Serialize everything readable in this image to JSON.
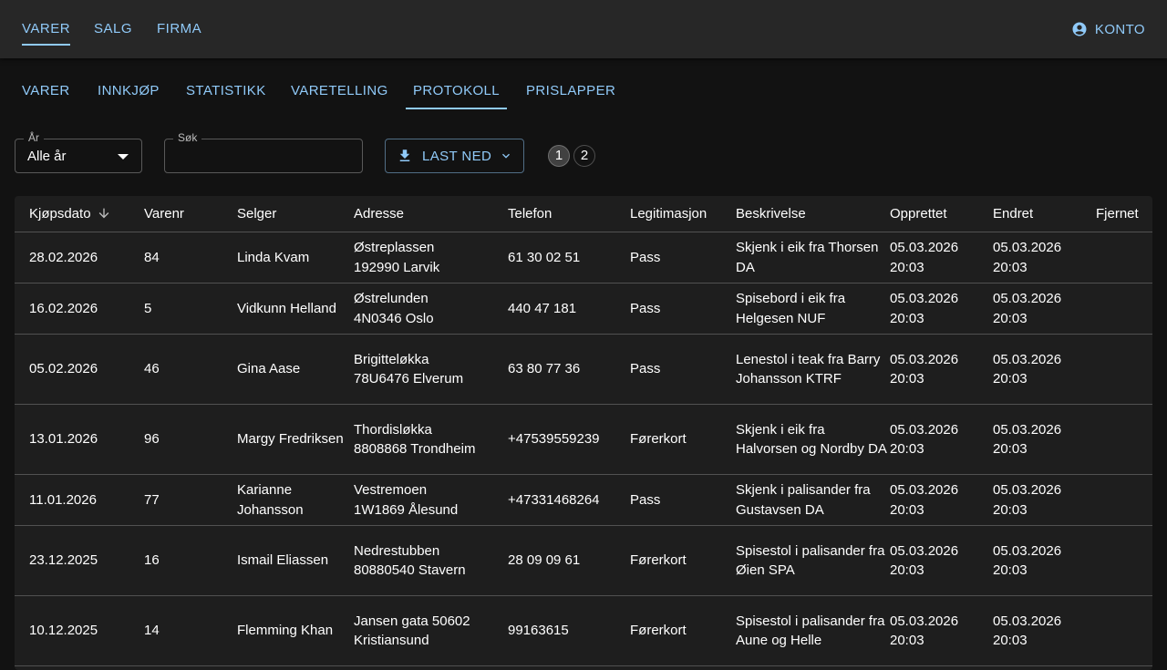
{
  "topnav": {
    "items": [
      {
        "label": "VARER"
      },
      {
        "label": "SALG"
      },
      {
        "label": "FIRMA"
      }
    ],
    "account_label": "KONTO"
  },
  "subtabs": [
    {
      "label": "VARER"
    },
    {
      "label": "INNKJØP"
    },
    {
      "label": "STATISTIKK"
    },
    {
      "label": "VARETELLING"
    },
    {
      "label": "PROTOKOLL"
    },
    {
      "label": "PRISLAPPER"
    }
  ],
  "filters": {
    "year_label": "År",
    "year_value": "Alle år",
    "search_label": "Søk",
    "search_value": "",
    "download_label": "LAST NED"
  },
  "pagination": [
    "1",
    "2"
  ],
  "colors": {
    "accent": "#90caf9",
    "background": "#121212",
    "surface": "#1e1e1e",
    "appbar": "#272727"
  },
  "table": {
    "columns": [
      "Kjøpsdato",
      "Varenr",
      "Selger",
      "Adresse",
      "Telefon",
      "Legitimasjon",
      "Beskrivelse",
      "Opprettet",
      "Endret",
      "Fjernet"
    ],
    "sort_column": "Kjøpsdato",
    "sort_direction": "descending",
    "rows": [
      {
        "date": "28.02.2026",
        "nr": "84",
        "seller": "Linda Kvam",
        "addr1": "Østreplassen",
        "addr2": "192990 Larvik",
        "phone": "61 30 02 51",
        "id": "Pass",
        "desc": "Skjenk i eik fra Thorsen DA",
        "created1": "05.03.2026",
        "created2": "20:03",
        "changed1": "05.03.2026",
        "changed2": "20:03"
      },
      {
        "date": "16.02.2026",
        "nr": "5",
        "seller": "Vidkunn Helland",
        "addr1": "Østrelunden",
        "addr2": "4N0346 Oslo",
        "phone": "440 47 181",
        "id": "Pass",
        "desc": "Spisebord i eik fra Helgesen NUF",
        "created1": "05.03.2026",
        "created2": "20:03",
        "changed1": "05.03.2026",
        "changed2": "20:03"
      },
      {
        "date": "05.02.2026",
        "nr": "46",
        "seller": "Gina Aase",
        "addr1": "Brigitteløkka",
        "addr2": "78U6476 Elverum",
        "phone": "63 80 77 36",
        "id": "Pass",
        "desc": "Lenestol i teak fra Barry Johansson KTRF",
        "created1": "05.03.2026",
        "created2": "20:03",
        "changed1": "05.03.2026",
        "changed2": "20:03"
      },
      {
        "date": "13.01.2026",
        "nr": "96",
        "seller": "Margy Fredriksen",
        "addr1": "Thordisløkka",
        "addr2": "8808868 Trondheim",
        "phone": "+47539559239",
        "id": "Førerkort",
        "desc": "Skjenk i eik fra Halvorsen og Nordby DA",
        "created1": "05.03.2026",
        "created2": "20:03",
        "changed1": "05.03.2026",
        "changed2": "20:03"
      },
      {
        "date": "11.01.2026",
        "nr": "77",
        "seller": "Karianne Johansson",
        "addr1": "Vestremoen",
        "addr2": "1W1869 Ålesund",
        "phone": "+47331468264",
        "id": "Pass",
        "desc": "Skjenk i palisander fra Gustavsen DA",
        "created1": "05.03.2026",
        "created2": "20:03",
        "changed1": "05.03.2026",
        "changed2": "20:03"
      },
      {
        "date": "23.12.2025",
        "nr": "16",
        "seller": "Ismail Eliassen",
        "addr1": "Nedrestubben",
        "addr2": "80880540 Stavern",
        "phone": "28 09 09 61",
        "id": "Førerkort",
        "desc": "Spisestol i palisander fra Øien SPA",
        "created1": "05.03.2026",
        "created2": "20:03",
        "changed1": "05.03.2026",
        "changed2": "20:03"
      },
      {
        "date": "10.12.2025",
        "nr": "14",
        "seller": "Flemming Khan",
        "addr1": "Jansen gata 50602",
        "addr2": "Kristiansund",
        "phone": "99163615",
        "id": "Førerkort",
        "desc": "Spisestol i palisander fra Aune og Helle",
        "created1": "05.03.2026",
        "created2": "20:03",
        "changed1": "05.03.2026",
        "changed2": "20:03"
      }
    ]
  }
}
